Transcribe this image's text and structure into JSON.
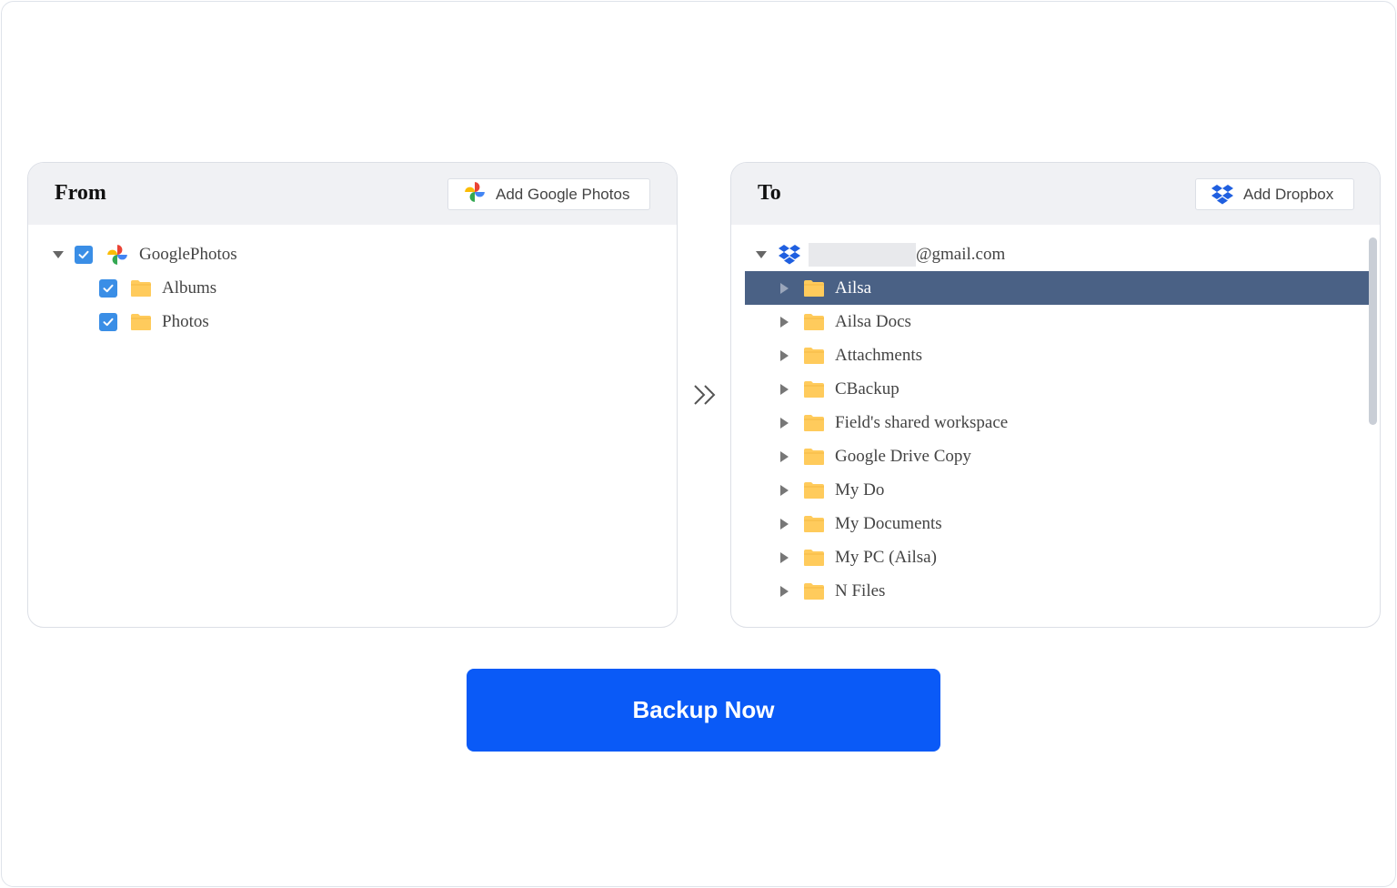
{
  "from_panel": {
    "title": "From",
    "add_button_label": "Add Google Photos",
    "root": {
      "label": "GooglePhotos",
      "checked": true,
      "expanded": true
    },
    "children": [
      {
        "label": "Albums",
        "checked": true
      },
      {
        "label": "Photos",
        "checked": true
      }
    ]
  },
  "to_panel": {
    "title": "To",
    "add_button_label": "Add Dropbox",
    "account_suffix": "@gmail.com",
    "folders": [
      {
        "label": "Ailsa",
        "selected": true
      },
      {
        "label": "Ailsa Docs"
      },
      {
        "label": "Attachments"
      },
      {
        "label": "CBackup"
      },
      {
        "label": "Field's shared workspace"
      },
      {
        "label": "Google Drive Copy"
      },
      {
        "label": "My Do"
      },
      {
        "label": "My Documents"
      },
      {
        "label": "My PC (Ailsa)"
      },
      {
        "label": "N Files"
      }
    ]
  },
  "transfer_arrow": "»",
  "backup_button_label": "Backup Now",
  "colors": {
    "accent": "#0a5af7",
    "selected_row": "#4a6185",
    "checkbox": "#3a8ee6",
    "folder": "#ffcb5c"
  }
}
